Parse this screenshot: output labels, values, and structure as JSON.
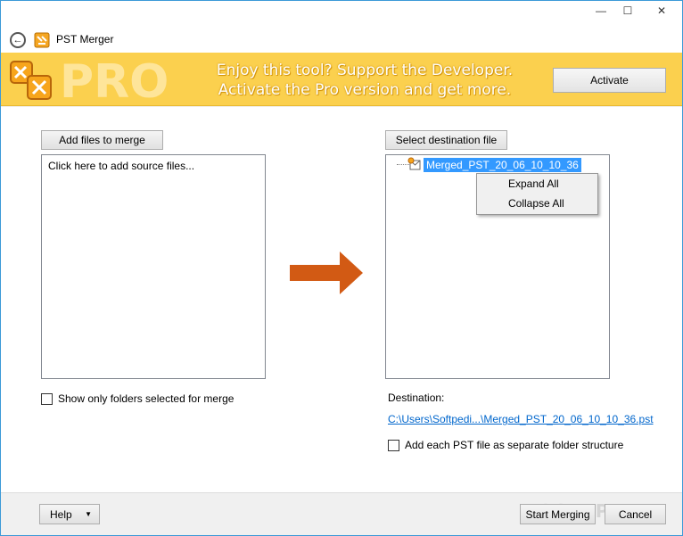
{
  "app": {
    "title": "PST Merger"
  },
  "window_controls": {
    "minimize": "—",
    "maximize": "☐",
    "close": "✕"
  },
  "banner": {
    "logo_text": "PRO",
    "line1": "Enjoy this tool? Support the Developer.",
    "line2": "Activate the Pro version and get more.",
    "activate_label": "Activate",
    "color": "#fbd04e"
  },
  "source": {
    "add_button": "Add files to merge",
    "hint": "Click here to add source files...",
    "show_selected_label": "Show only folders selected for merge",
    "show_selected_checked": false
  },
  "destination": {
    "select_button": "Select destination file",
    "tree_root": "Merged_PST_20_06_10_10_36",
    "label": "Destination:",
    "path": "C:\\Users\\Softpedi...\\Merged_PST_20_06_10_10_36.pst",
    "separate_folder_label": "Add each PST file as separate folder structure",
    "separate_folder_checked": false
  },
  "context_menu": {
    "items": [
      "Expand All",
      "Collapse All"
    ]
  },
  "arrow_color": "#d25a14",
  "footer": {
    "help_label": "Help",
    "help_arrow": "▼",
    "start_label": "Start Merging",
    "cancel_label": "Cancel"
  },
  "watermark": "SOFTPEDIA"
}
